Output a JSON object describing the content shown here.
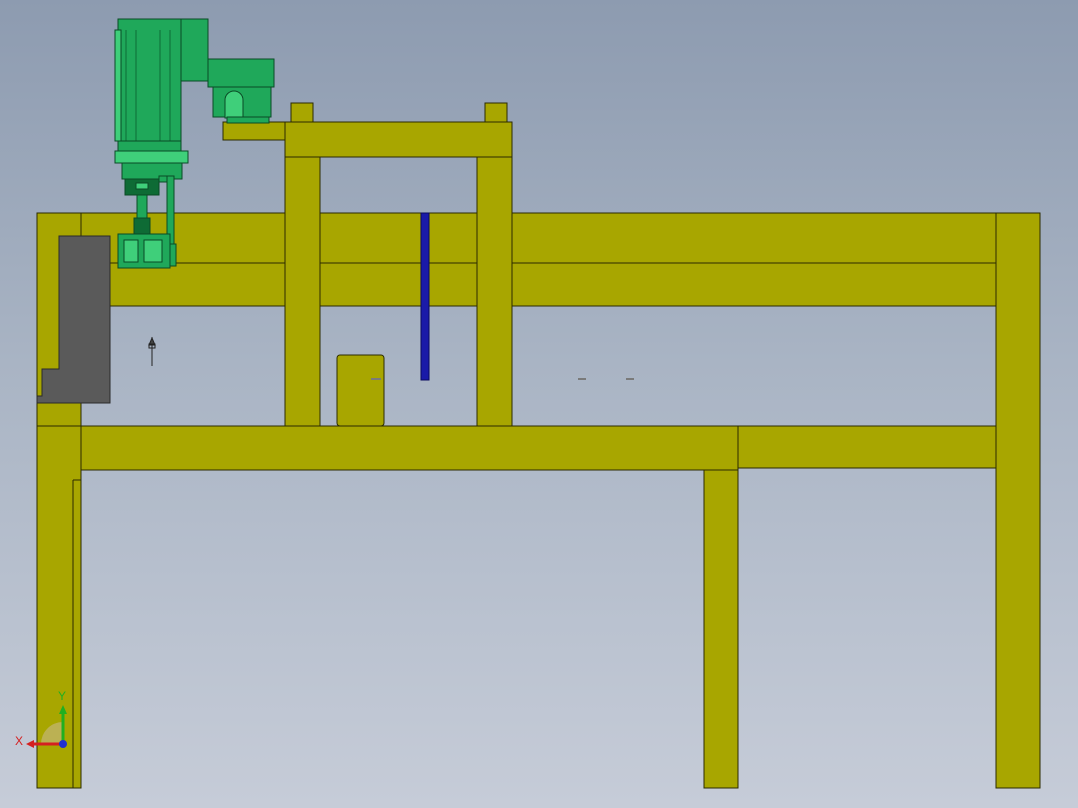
{
  "colors": {
    "frame": "#a8a600",
    "frame_edge": "#2b2b00",
    "motor_green": "#1fa85a",
    "motor_dark": "#0e6b35",
    "motor_light": "#3fcf7a",
    "block_gray": "#5a5a5a",
    "rod_blue": "#1a1aa8",
    "axis_x": "#d42020",
    "axis_y": "#20b020",
    "axis_z": "#2030d0"
  },
  "triad": {
    "x_label": "X",
    "y_label": "Y"
  }
}
